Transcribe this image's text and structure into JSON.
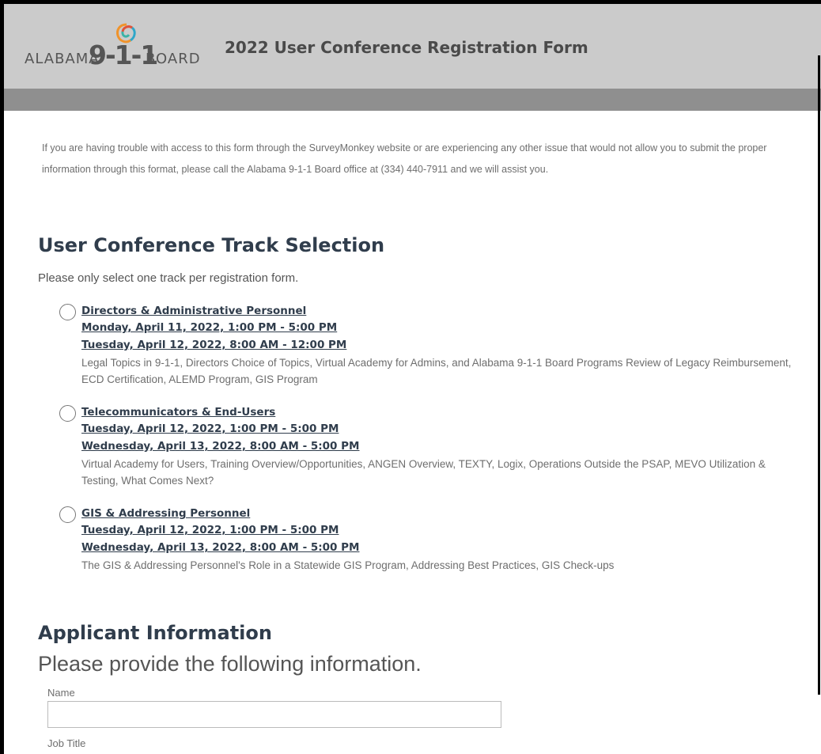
{
  "header": {
    "logo": {
      "left_text": "ALABAMA",
      "number_text": "9-1-1",
      "right_text": "BOARD"
    },
    "title": "2022 User Conference Registration Form"
  },
  "intro_text": "If you are having trouble with access to this form through the SurveyMonkey website or are experiencing any other issue that would not allow you to submit the proper information through this format, please call the Alabama 9-1-1 Board office at (334) 440-7911 and we will assist you.",
  "track_section": {
    "title": "User Conference Track Selection",
    "instruction": "Please only select one track per registration form.",
    "tracks": [
      {
        "name": "Directors & Administrative Personnel",
        "session1": "Monday, April 11, 2022, 1:00 PM - 5:00 PM",
        "session2": "Tuesday, April 12, 2022, 8:00 AM - 12:00 PM",
        "description": "Legal Topics in 9-1-1, Directors Choice of Topics, Virtual Academy for Admins, and Alabama 9-1-1 Board Programs Review of Legacy Reimbursement, ECD Certification, ALEMD Program, GIS Program"
      },
      {
        "name": "Telecommunicators & End-Users",
        "session1": "Tuesday, April 12, 2022, 1:00 PM - 5:00 PM",
        "session2": "Wednesday, April 13, 2022, 8:00 AM - 5:00 PM",
        "description": "Virtual Academy for Users, Training Overview/Opportunities, ANGEN Overview, TEXTY, Logix, Operations Outside the PSAP, MEVO Utilization & Testing, What Comes Next?"
      },
      {
        "name": "GIS & Addressing Personnel",
        "session1": "Tuesday, April 12, 2022, 1:00 PM - 5:00 PM",
        "session2": "Wednesday, April 13, 2022, 8:00 AM - 5:00 PM",
        "description": "The GIS & Addressing Personnel's Role in a Statewide GIS Program, Addressing Best Practices, GIS Check-ups"
      }
    ]
  },
  "applicant_section": {
    "title": "Applicant Information",
    "subtitle": "Please provide the following information.",
    "fields": [
      {
        "label": "Name",
        "value": ""
      },
      {
        "label": "Job Title"
      }
    ]
  },
  "colors": {
    "header_bg": "#cbcbcb",
    "header_band": "#8f8f8f",
    "heading": "#303d4c",
    "body_text": "#6e6e6e"
  }
}
